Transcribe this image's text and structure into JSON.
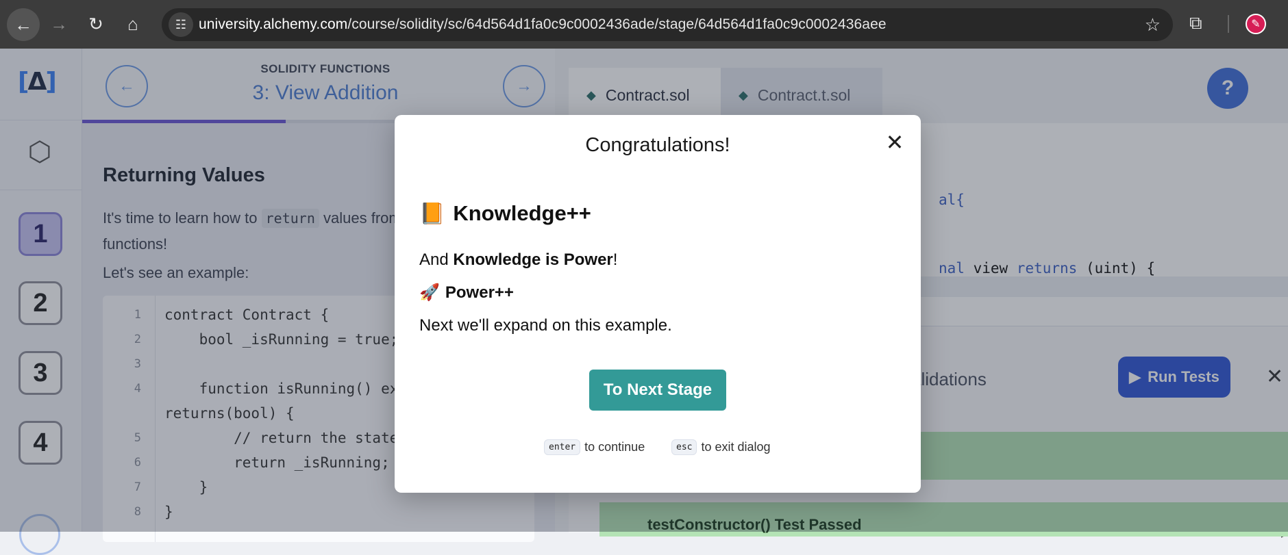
{
  "browser": {
    "url_host": "university.alchemy.com",
    "url_path": "/course/solidity/sc/64d564d1fa0c9c0002436ade/stage/64d564d1fa0c9c0002436aee",
    "icons": [
      "back-icon",
      "forward-icon",
      "reload-icon",
      "home-icon",
      "site-info-icon",
      "bookmark-star-icon",
      "extensions-icon",
      "profile-avatar"
    ]
  },
  "app": {
    "logo_text": "Δ",
    "stages": [
      "1",
      "2",
      "3",
      "4"
    ],
    "active_stage": "1",
    "course_label": "SOLIDITY FUNCTIONS",
    "stage_title": "3: View Addition",
    "progress_fraction": 0.43,
    "lesson": {
      "heading": "Returning Values",
      "para_before": "It's time to learn how to ",
      "para_code": "return",
      "para_after": " values from functions!",
      "example_intro": "Let's see an example:",
      "code_lines": [
        {
          "n": "1",
          "t": "contract Contract {"
        },
        {
          "n": "2",
          "t": "    bool _isRunning = true;"
        },
        {
          "n": "3",
          "t": ""
        },
        {
          "n": "4",
          "t": "    function isRunning() external view"
        },
        {
          "n": "",
          "t": "returns(bool) {"
        },
        {
          "n": "5",
          "t": "        // return the state variable"
        },
        {
          "n": "6",
          "t": "        return _isRunning;"
        },
        {
          "n": "7",
          "t": "    }"
        },
        {
          "n": "8",
          "t": "}"
        }
      ]
    },
    "editor": {
      "tabs": [
        "Contract.sol",
        "Contract.t.sol"
      ],
      "code_fragments": {
        "line1": "al{",
        "line2_kw1": "nal",
        "line2_mid": " view ",
        "line2_kw2": "returns",
        "line2_end": " (uint) {"
      },
      "validations_label": "alidations",
      "run_tests_label": "Run Tests",
      "test_result": "testConstructor()   Test Passed"
    }
  },
  "modal": {
    "title": "Congratulations!",
    "heading_emoji": "📙",
    "heading": "Knowledge++",
    "line1_prefix": "And ",
    "line1_bold": "Knowledge is Power",
    "line1_suffix": "!",
    "subheading_emoji": "🚀",
    "subheading": "Power++",
    "line2": "Next we'll expand on this example.",
    "next_button": "To Next Stage",
    "hint_enter_key": "enter",
    "hint_enter_text": "to continue",
    "hint_esc_key": "esc",
    "hint_esc_text": "to exit dialog"
  }
}
